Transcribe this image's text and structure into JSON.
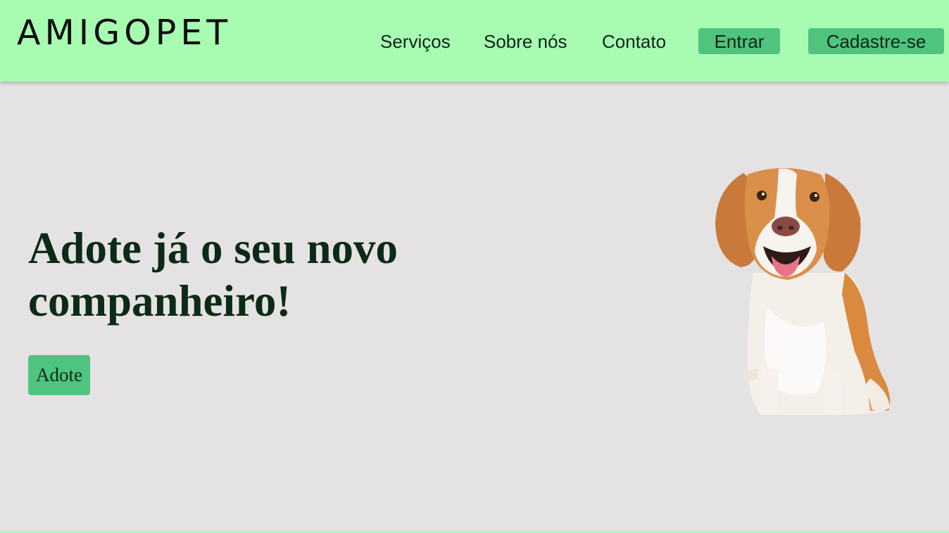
{
  "header": {
    "logo": "AMIGOPET",
    "nav": {
      "services": "Serviços",
      "about": "Sobre nós",
      "contact": "Contato",
      "login": "Entrar",
      "signup": "Cadastre-se"
    }
  },
  "hero": {
    "title": "Adote já o seu novo companheiro!",
    "cta": "Adote"
  },
  "colors": {
    "header_bg": "#a7fcb2",
    "page_bg": "#e4e2e3",
    "accent": "#4ec47f",
    "title_text": "#0d2a16"
  }
}
